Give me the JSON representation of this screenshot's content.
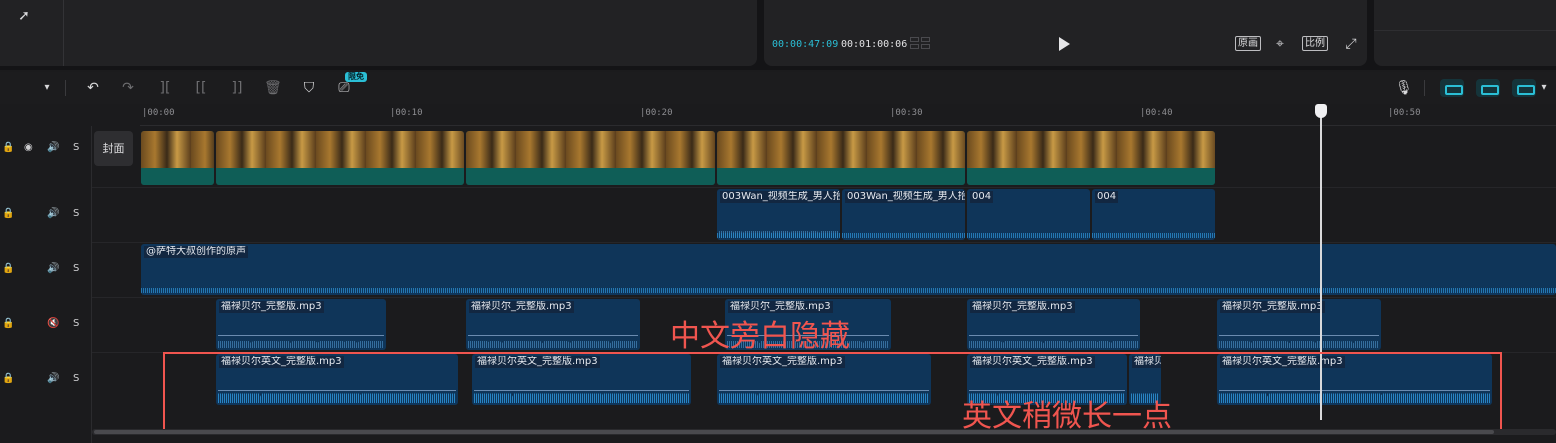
{
  "player": {
    "current_time": "00:00:47:09",
    "total_time": "00:01:00:06",
    "btn_original": "原画",
    "btn_ratio": "比例"
  },
  "toolbar": {
    "badge": "限免"
  },
  "ruler": {
    "labels": [
      "|00:00",
      "|00:10",
      "|00:20",
      "|00:30",
      "|00:40",
      "|00:50"
    ]
  },
  "tracks": {
    "solo_label": "S",
    "cover_label": "封面"
  },
  "video_audio_track": {
    "clips": [
      "003Wan_视频生成_男人抬",
      "003Wan_视频生成_男人抬",
      "004",
      "004"
    ]
  },
  "narration_track": {
    "label": "@萨特大叔创作的原声"
  },
  "chinese_track": {
    "clips": [
      "福禄贝尔_完整版.mp3",
      "福禄贝尔_完整版.mp3",
      "福禄贝尔_完整版.mp3",
      "福禄贝尔_完整版.mp3",
      "福禄贝尔_完整版.mp3"
    ]
  },
  "english_track": {
    "clips": [
      "福禄贝尔英文_完整版.mp3",
      "福禄贝尔英文_完整版.mp3",
      "福禄贝尔英文_完整版.mp3",
      "福禄贝尔英文_完整版.mp3",
      "福禄贝",
      "福禄贝尔英文_完整版.mp3"
    ]
  },
  "annotations": {
    "chinese_note": "中文旁白隐藏",
    "english_note": "英文稍微长一点"
  },
  "colors": {
    "accent": "#2bbfd6",
    "annotation": "#f0554f",
    "audio_clip": "#0f3559",
    "video_bar": "#0f5e57"
  }
}
